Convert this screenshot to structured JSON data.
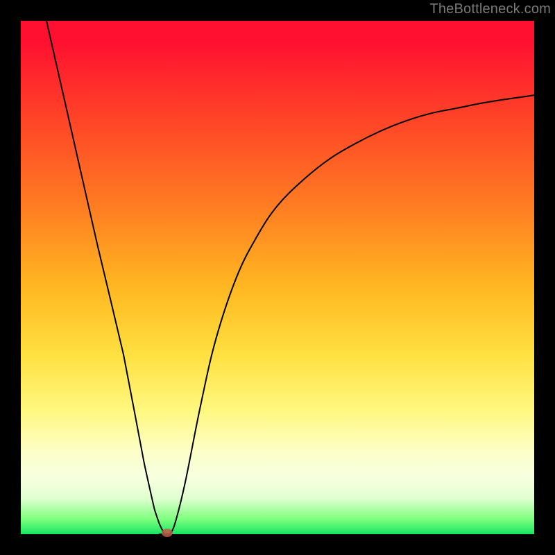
{
  "watermark": "TheBottleneck.com",
  "chart_data": {
    "type": "line",
    "title": "",
    "xlabel": "",
    "ylabel": "",
    "xlim": [
      0,
      100
    ],
    "ylim": [
      0,
      100
    ],
    "grid": false,
    "legend": false,
    "background_gradient": {
      "stops": [
        {
          "pos": 0.0,
          "color": "#ff1030"
        },
        {
          "pos": 0.36,
          "color": "#ff7c22"
        },
        {
          "pos": 0.65,
          "color": "#ffe040"
        },
        {
          "pos": 0.89,
          "color": "#f7ffe0"
        },
        {
          "pos": 1.0,
          "color": "#16e662"
        }
      ]
    },
    "series": [
      {
        "name": "bottleneck-curve",
        "x": [
          5,
          10,
          15,
          20,
          24,
          26,
          27,
          28,
          29,
          30,
          32,
          35,
          38,
          42,
          46,
          50,
          55,
          60,
          65,
          70,
          75,
          80,
          85,
          90,
          95,
          100
        ],
        "y": [
          100,
          78,
          56,
          35,
          14,
          5,
          2,
          0,
          0,
          2,
          10,
          25,
          38,
          50,
          58,
          64,
          69,
          73,
          76,
          78.5,
          80.5,
          82,
          83,
          84,
          84.8,
          85.5
        ]
      }
    ],
    "marker": {
      "x": 28.5,
      "y": 0,
      "color": "#c15b49"
    },
    "curve_min_region": {
      "x_start": 27,
      "x_end": 29,
      "y": 0
    }
  }
}
